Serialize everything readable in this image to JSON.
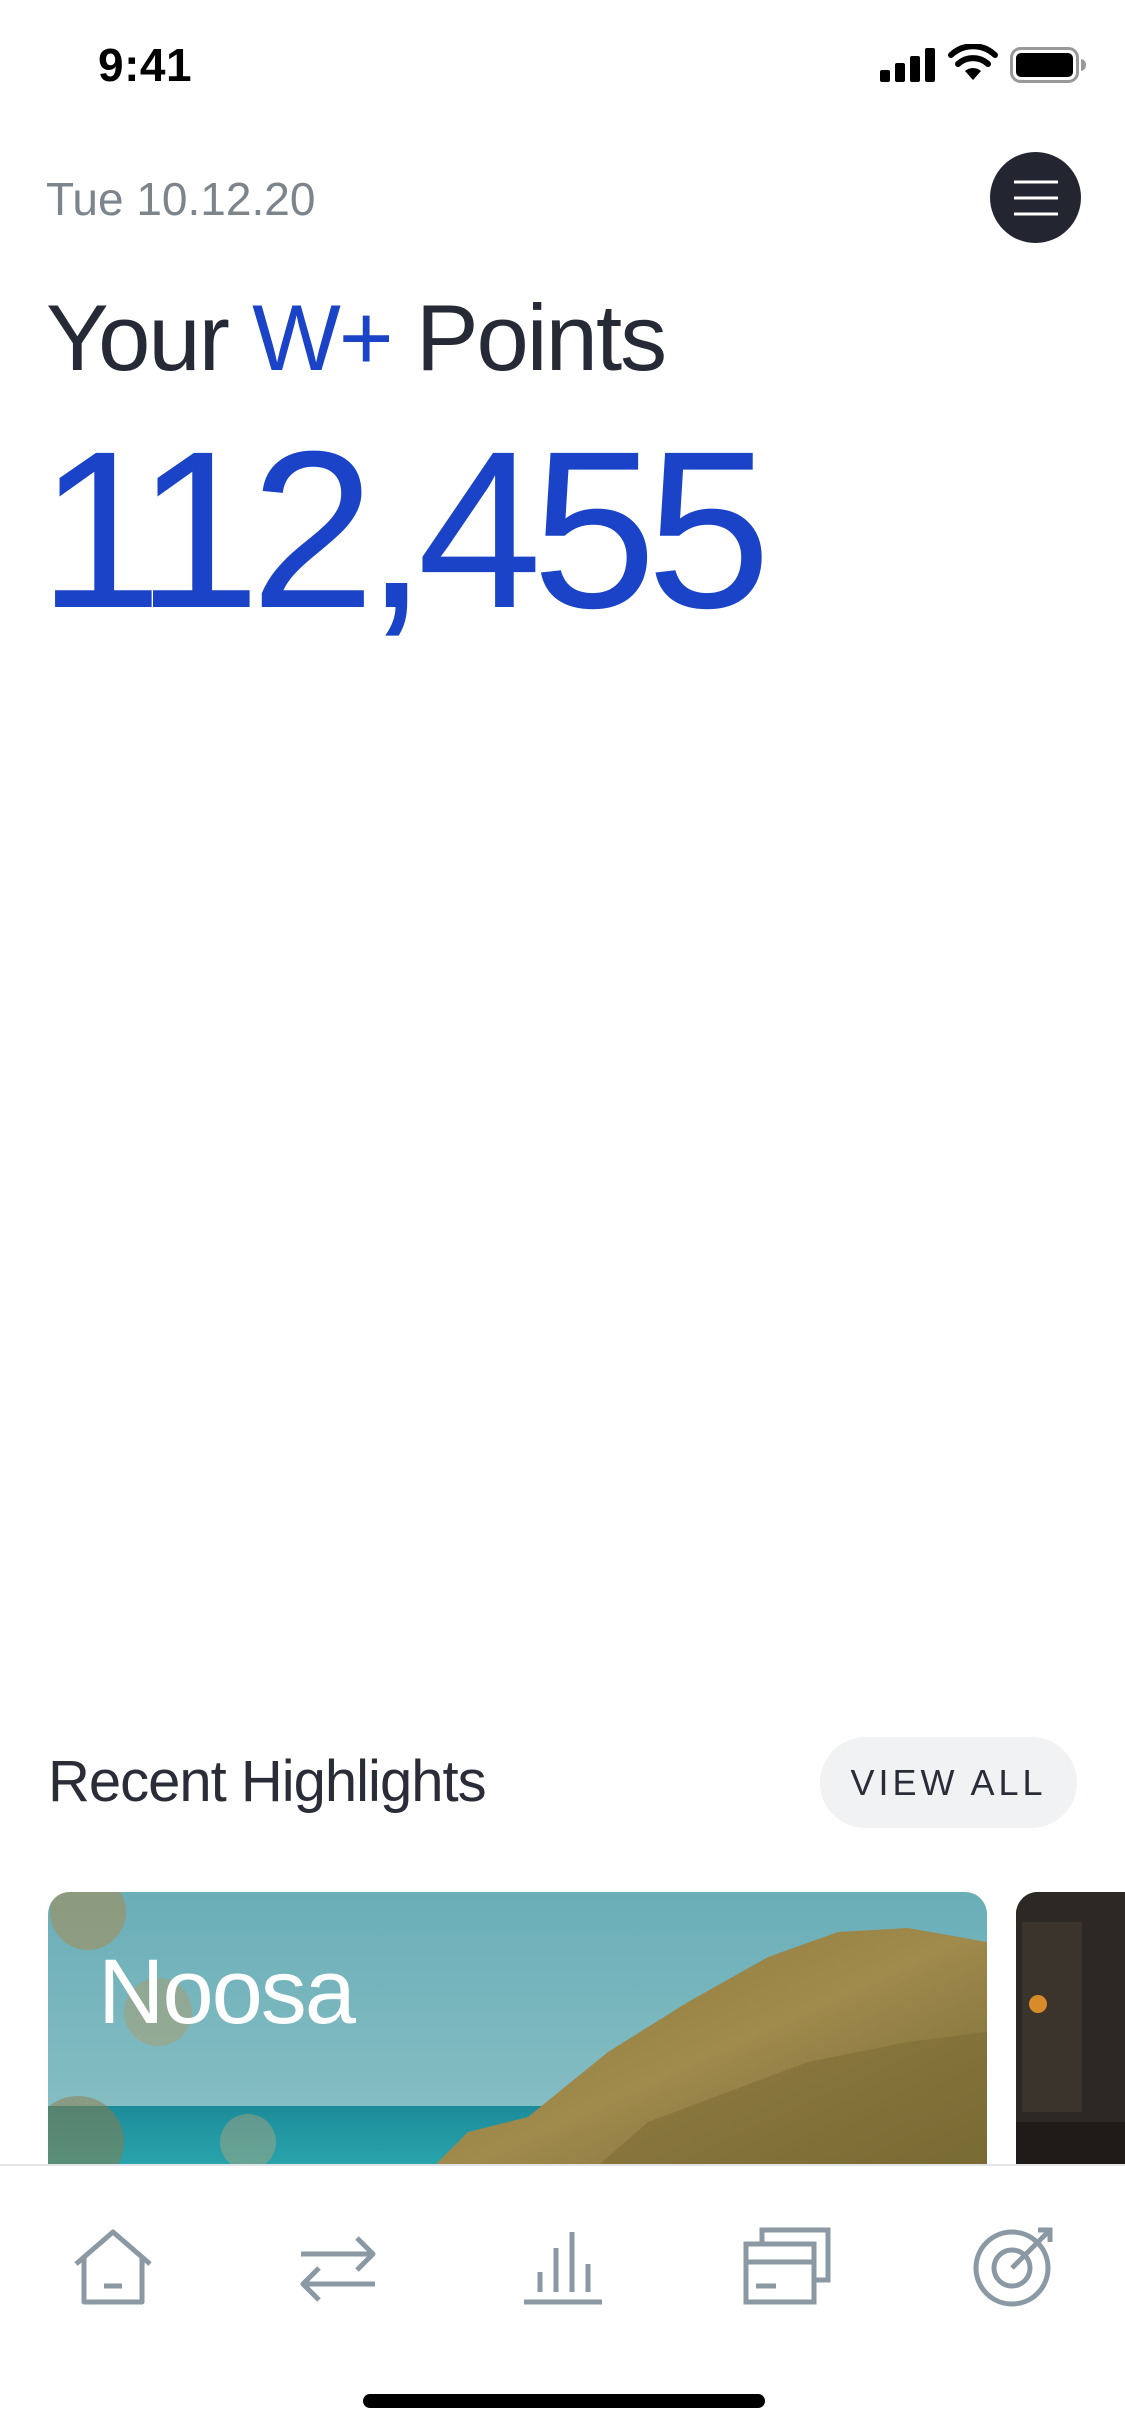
{
  "status_bar": {
    "time": "9:41"
  },
  "header": {
    "date": "Tue 10.12.20"
  },
  "points": {
    "title_prefix": "Your",
    "title_brand": "W+",
    "title_suffix": "Points",
    "value": "112,455"
  },
  "highlights": {
    "title": "Recent Highlights",
    "view_all_label": "VIEW ALL",
    "cards": [
      {
        "title": "Noosa"
      }
    ]
  },
  "tab_bar": {
    "items": [
      {
        "icon": "home-icon"
      },
      {
        "icon": "transfer-icon"
      },
      {
        "icon": "stats-icon"
      },
      {
        "icon": "cards-icon"
      },
      {
        "icon": "target-icon"
      }
    ]
  },
  "colors": {
    "brand": "#1a43c8",
    "text": "#272b3a",
    "muted": "#7c848c",
    "icon": "#8a99a3"
  }
}
